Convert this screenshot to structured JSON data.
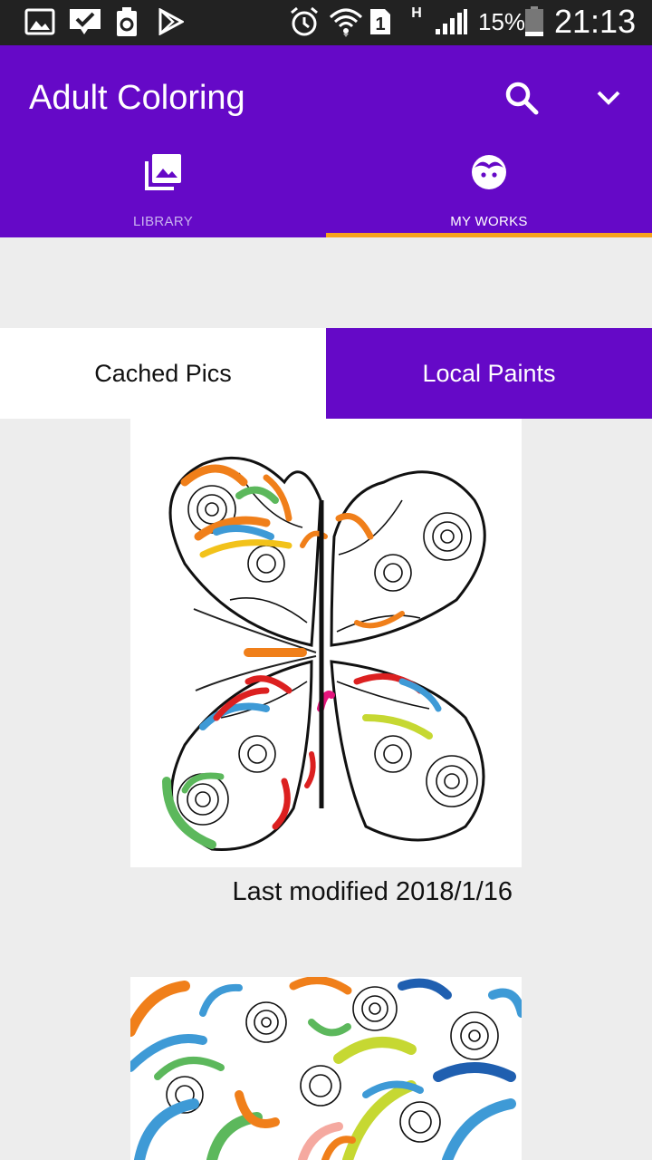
{
  "status_bar": {
    "battery_percent": "15%",
    "time": "21:13",
    "sim_number": "1",
    "network_type": "H",
    "icons": [
      "gallery-icon",
      "voicemail-check-icon",
      "recycle-icon",
      "play-store-icon",
      "alarm-icon",
      "wifi-icon",
      "sim-icon",
      "signal-icon",
      "battery-icon"
    ]
  },
  "app_bar": {
    "title": "Adult Coloring",
    "background": "#6509c7",
    "icons": [
      "search-icon",
      "chevron-down-icon"
    ]
  },
  "tabs": [
    {
      "label": "LIBRARY",
      "icon": "library-icon",
      "active": false
    },
    {
      "label": "MY WORKS",
      "icon": "face-icon",
      "active": true
    }
  ],
  "tab_indicator_color": "#f7a21b",
  "sub_tabs": [
    {
      "label": "Cached Pics",
      "active": false
    },
    {
      "label": "Local Paints",
      "active": true
    }
  ],
  "works": [
    {
      "image": "butterfly coloring page",
      "caption": "Last modified 2018/1/16"
    },
    {
      "image": "waves coloring page"
    }
  ]
}
